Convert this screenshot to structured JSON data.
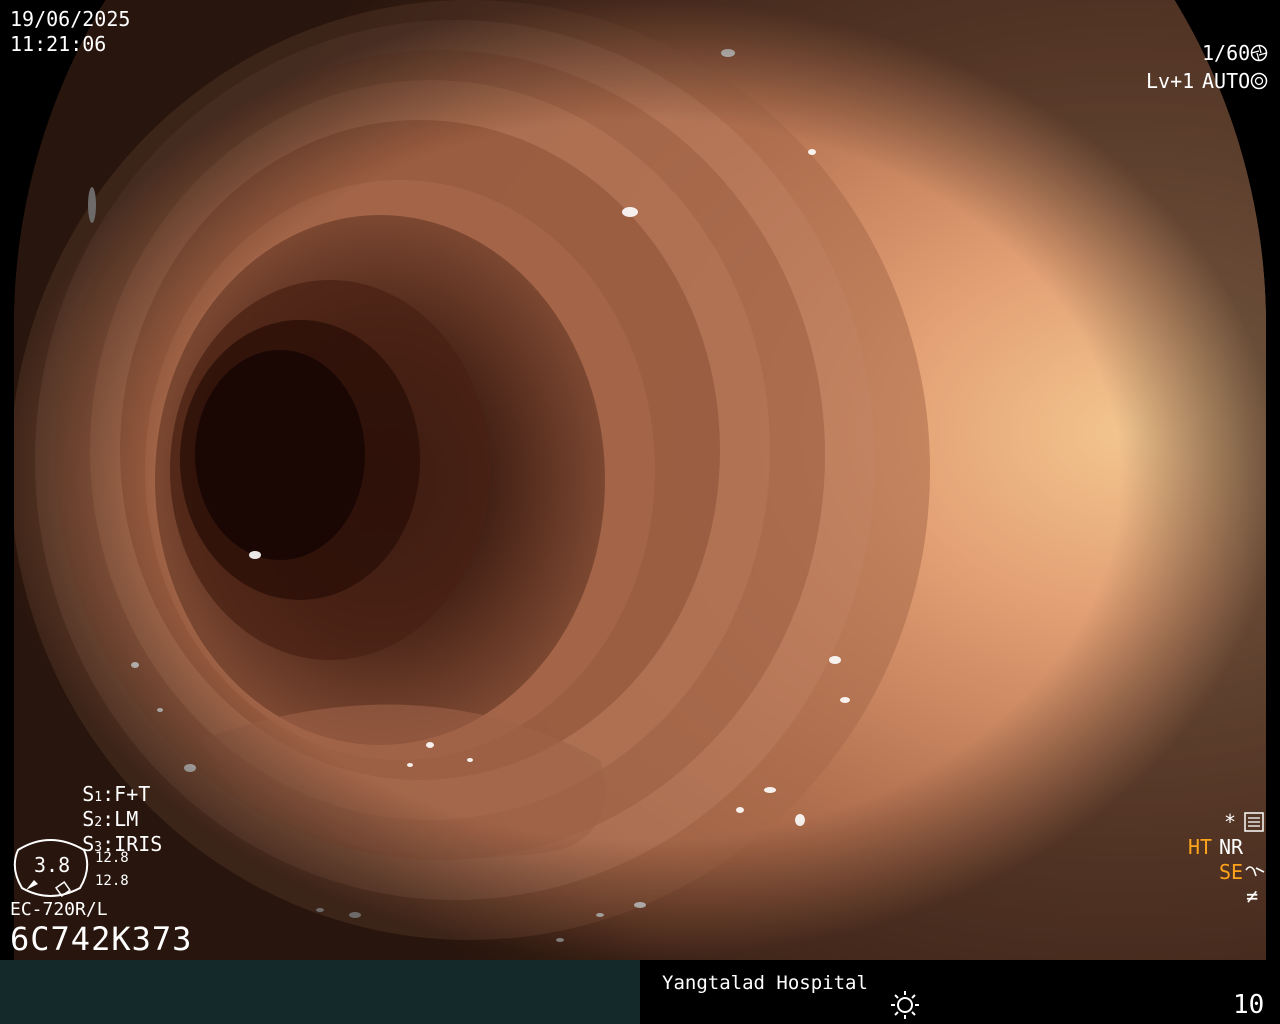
{
  "osd": {
    "date": "19/06/2025",
    "time": "11:21:06",
    "shutter": "1/60",
    "shutter_icon": "shutter-icon",
    "light_level": "Lv+1",
    "iris_mode": "AUTO",
    "iris_icon": "auto-iris-icon",
    "settings": [
      {
        "key": "S",
        "num": "1",
        "value": "F+T"
      },
      {
        "key": "S",
        "num": "2",
        "value": "LM"
      },
      {
        "key": "S",
        "num": "3",
        "value": "IRIS"
      }
    ],
    "gauge_value": "3.8",
    "gauge_icon": "scope-tip-gauge-icon",
    "gauge_side_top": "12.8",
    "gauge_side_bottom": "12.8",
    "scope_model": "EC-720R/L",
    "serial_number": "6C742K373",
    "right_mark": "*",
    "right_mark_icon": "menu-list-icon",
    "ht_label": "HT",
    "nr_label": "NR",
    "se_label": "SE",
    "se_icon": "structure-enhance-icon",
    "not_equal_mark": "≠",
    "colors": {
      "accent_orange": "#ffa31a",
      "bar_left": "#142a2a"
    }
  },
  "footer": {
    "hospital": "Yangtalad Hospital",
    "light_icon": "sun-brightness-icon",
    "counter": "10"
  }
}
